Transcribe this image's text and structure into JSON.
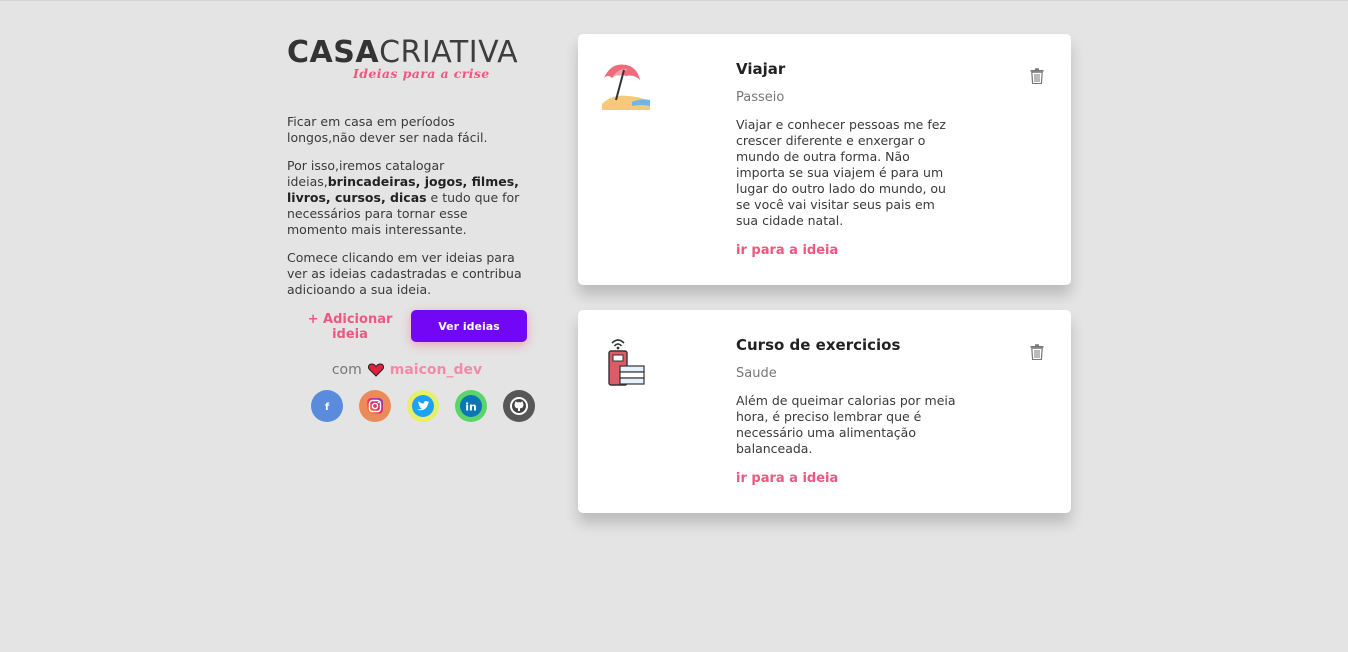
{
  "logo": {
    "main_bold": "CASA",
    "main_light": "CRIATIVA",
    "tagline": "Ideias para a crise"
  },
  "intro": {
    "p1": "Ficar em casa em períodos longos,não dever ser nada fácil.",
    "p2_start": "Por isso,iremos catalogar ideias,",
    "p2_bold": "brincadeiras, jogos, filmes, livros, cursos, dicas",
    "p2_end": " e tudo que for necessários para tornar esse momento mais interessante.",
    "p3": "Comece clicando em ver ideias para ver as ideias cadastradas e contribua adicioando a sua ideia."
  },
  "actions": {
    "add_label": "+ Adicionar ideia",
    "view_label": "Ver ideias"
  },
  "credit": {
    "prefix": "com",
    "author": "maicon_dev"
  },
  "socials": [
    {
      "name": "facebook",
      "icon": "facebook-icon",
      "glyph": "f",
      "color": "#5b8bdc"
    },
    {
      "name": "instagram",
      "icon": "instagram-icon",
      "glyph": "◎",
      "color": "#ec8a5a"
    },
    {
      "name": "twitter",
      "icon": "twitter-icon",
      "glyph": "🐦",
      "color": "#e6ee6a"
    },
    {
      "name": "linkedin",
      "icon": "linkedin-icon",
      "glyph": "in",
      "color": "#5bd468"
    },
    {
      "name": "github",
      "icon": "github-icon",
      "glyph": "⚙",
      "color": "#575757"
    }
  ],
  "ideas": [
    {
      "icon": "beach-umbrella-icon",
      "title": "Viajar",
      "category": "Passeio",
      "description": "Viajar e conhecer pessoas me fez crescer diferente e enxergar o mundo de outra forma. Não importa se sua viajem é para um lugar do outro lado do mundo, ou se você vai visitar seus pais em sua cidade natal.",
      "link": "ir para a ideia"
    },
    {
      "icon": "online-course-books-icon",
      "title": "Curso de exercicios",
      "category": "Saude",
      "description": "Além de queimar calorias por meia hora, é preciso lembrar que é necessário uma alimentação balanceada.",
      "link": "ir para a ideia"
    }
  ],
  "colors": {
    "accent_pink": "#f0567f",
    "primary_purple": "#7107f5",
    "background": "#e4e4e4"
  }
}
